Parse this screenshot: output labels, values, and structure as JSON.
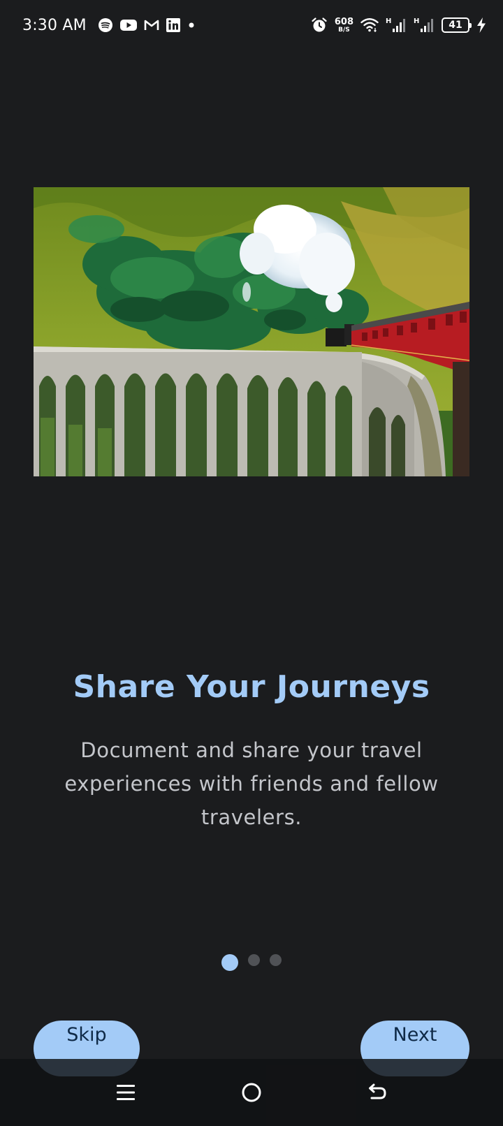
{
  "status_bar": {
    "time": "3:30 AM",
    "left_icons": [
      "spotify-icon",
      "youtube-icon",
      "gmail-icon",
      "linkedin-icon",
      "dot-icon"
    ],
    "net_speed_value": "608",
    "net_speed_unit": "B/S",
    "network_type_1": "H",
    "network_type_2": "H",
    "battery_level": "41",
    "right_icons": [
      "alarm-icon",
      "wifi-icon",
      "signal-icon",
      "signal-icon",
      "battery-icon",
      "charging-icon"
    ]
  },
  "onboarding": {
    "title": "Share Your Journeys",
    "description": "Document and share your travel experiences with friends and fellow travelers.",
    "page_count": 3,
    "current_page": 1
  },
  "buttons": {
    "skip_label": "Skip",
    "next_label": "Next"
  },
  "colors": {
    "background": "#1b1c1e",
    "accent": "#a3cbf7",
    "button_text": "#0f2a47",
    "description_text": "#c4c6cb",
    "dot_inactive": "#505256"
  },
  "nav_bar": {
    "icons": [
      "menu-icon",
      "home-icon",
      "back-icon"
    ]
  }
}
